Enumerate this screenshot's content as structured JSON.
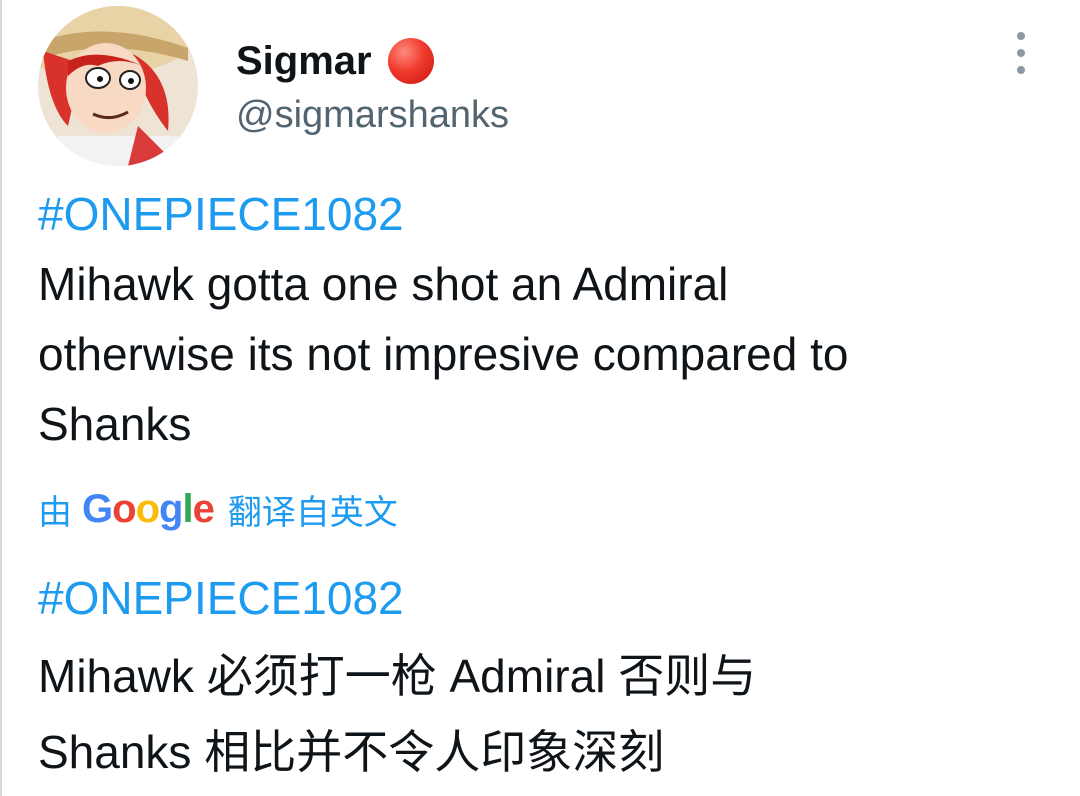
{
  "author": {
    "display_name": "Sigmar",
    "handle": "@sigmarshanks",
    "avatar_icon": "avatar-image",
    "status_icon": "red-circle-emoji"
  },
  "menu": {
    "more_icon": "more-vertical-icon"
  },
  "original": {
    "hashtag": "#ONEPIECE1082",
    "lines": [
      "Mihawk gotta one shot an Admiral",
      "otherwise its not impresive compared to",
      "Shanks"
    ]
  },
  "translation_note": {
    "prefix": "由",
    "brand": "Google",
    "suffix": "翻译自英文"
  },
  "translated": {
    "hashtag": "#ONEPIECE1082",
    "lines": [
      "Mihawk 必须打一枪 Admiral 否则与",
      "Shanks 相比并不令人印象深刻"
    ]
  },
  "colors": {
    "link": "#1d9bf0",
    "text": "#0f1419",
    "secondary": "#536471",
    "google_blue": "#4285f4",
    "google_red": "#ea4335",
    "google_yellow": "#fbbc05",
    "google_green": "#34a853"
  }
}
